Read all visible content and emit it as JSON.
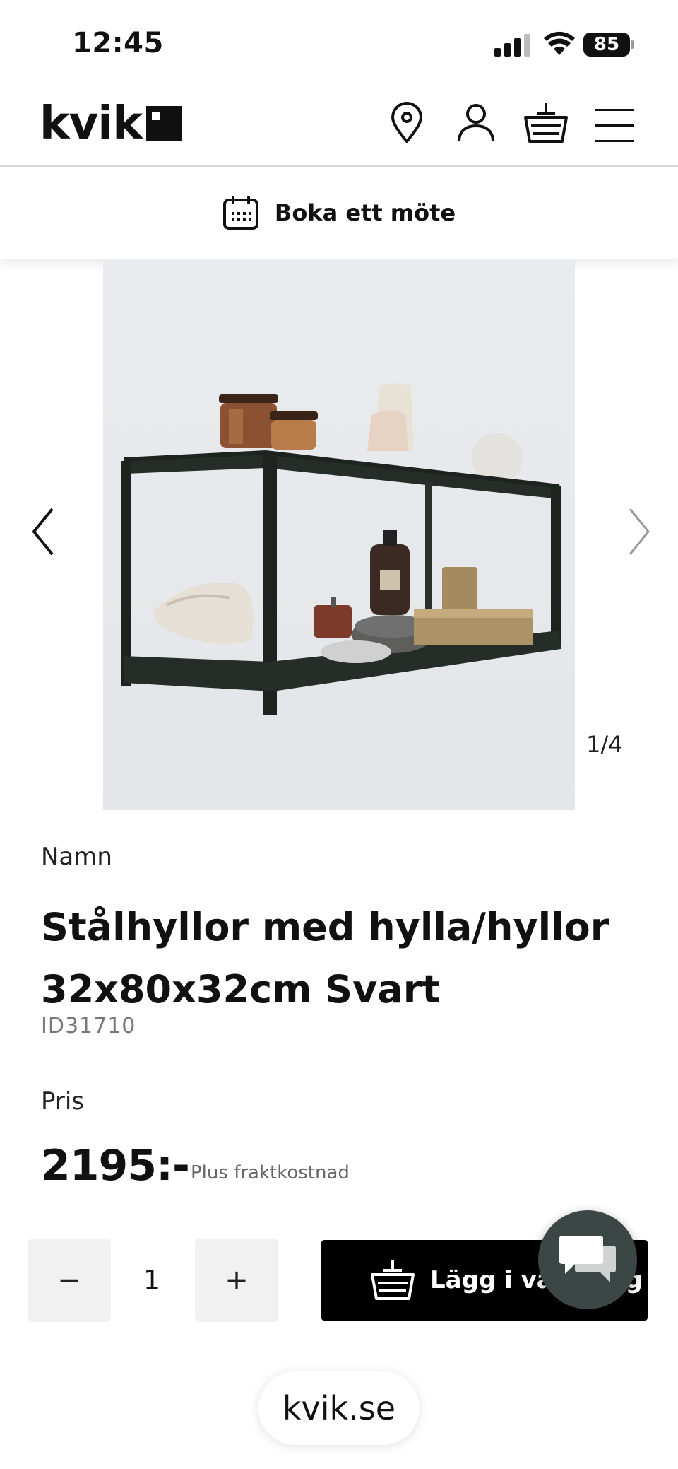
{
  "status_bar": {
    "time": "12:45",
    "battery": "85"
  },
  "header": {
    "logo_text": "kvik"
  },
  "booking": {
    "label": "Boka ett möte"
  },
  "gallery": {
    "counter": "1/4"
  },
  "product": {
    "name_label": "Namn",
    "title_line1": "Stålhyllor med hylla/hyllor",
    "title_line2": "32x80x32cm Svart",
    "id": "ID31710",
    "price_label": "Pris",
    "price": "2195:-",
    "shipping_note": "Plus fraktkostnad"
  },
  "quantity": {
    "minus": "−",
    "value": "1",
    "plus": "+"
  },
  "cart_button": {
    "label": "Lägg i varukorg"
  },
  "browser": {
    "url": "kvik.se"
  }
}
